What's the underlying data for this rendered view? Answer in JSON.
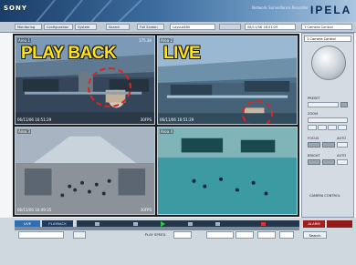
{
  "header": {
    "brand": "SONY",
    "system_name": "Network Surveillance Recorder",
    "logo": "IPELA"
  },
  "toolbar": {
    "monitoring": "Monitoring",
    "configuration": "Configuration",
    "system": "System",
    "search": "Search",
    "full_screen": "Full Screen",
    "layout": "Layout4B0",
    "date": "06/11/06 16:51:29",
    "camera_control": "1 Camera Control"
  },
  "cameras": [
    {
      "area": "Area 1",
      "overlay_label": "PLAY BACK",
      "timestamp": "06/11/06 16:51:29",
      "fps": "30FPS",
      "timecode": "175.30"
    },
    {
      "area": "Area 2",
      "overlay_label": "LIVE",
      "timestamp": "06/11/06 16:51:29",
      "fps": "",
      "timecode": ""
    },
    {
      "area": "Area 3",
      "overlay_label": "",
      "timestamp": "06/11/06 16:49:35",
      "fps": "30FPS",
      "timecode": ""
    },
    {
      "area": "Area 4",
      "overlay_label": "",
      "timestamp": "",
      "fps": "",
      "timecode": ""
    }
  ],
  "panel": {
    "preset": "PRESET",
    "zoom": "ZOOM",
    "focus": "FOCUS",
    "auto": "AUTO",
    "bright": "BRIGHT",
    "camera_control": "CAMERA CONTROL"
  },
  "controls": {
    "live": "LIVE",
    "playback": "PLAYBACK",
    "play_speed": "PLAY SPEED",
    "alarm": "ALARM",
    "search": "Search"
  },
  "colors": {
    "overlay_text": "#ffe21a",
    "ring": "#e3221b",
    "header_dark": "#1b3d68"
  }
}
